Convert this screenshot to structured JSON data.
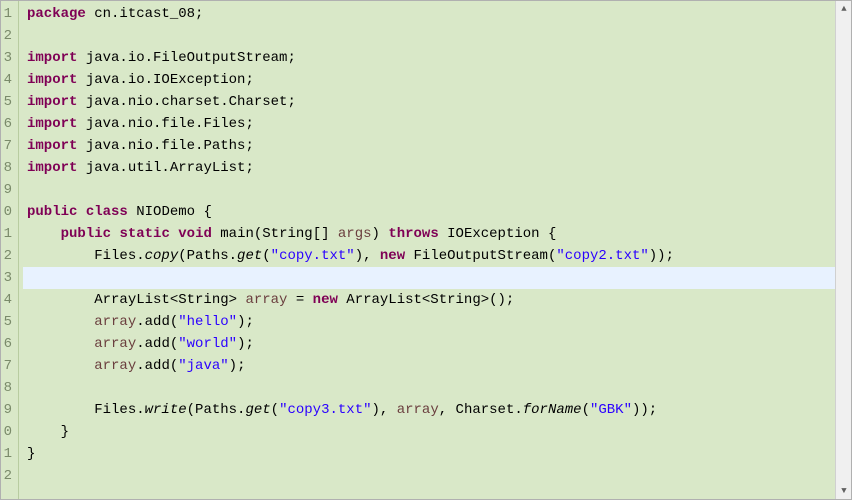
{
  "gutter": {
    "lines": [
      "1",
      "2",
      "3",
      "4",
      "5",
      "6",
      "7",
      "8",
      "9",
      "0",
      "1",
      "2",
      "3",
      "4",
      "5",
      "6",
      "7",
      "8",
      "9",
      "0",
      "1",
      "2"
    ]
  },
  "code": {
    "l1": {
      "kw": "package",
      "rest": " cn.itcast_08;"
    },
    "l3": {
      "kw": "import",
      "rest": " java.io.FileOutputStream;"
    },
    "l4": {
      "kw": "import",
      "rest": " java.io.IOException;"
    },
    "l5": {
      "kw": "import",
      "rest": " java.nio.charset.Charset;"
    },
    "l6": {
      "kw": "import",
      "rest": " java.nio.file.Files;"
    },
    "l7": {
      "kw": "import",
      "rest": " java.nio.file.Paths;"
    },
    "l8": {
      "kw": "import",
      "rest": " java.util.ArrayList;"
    },
    "l10": {
      "kw1": "public",
      "kw2": "class",
      "name": " NIODemo {"
    },
    "l11": {
      "indent": "    ",
      "kw1": "public",
      "kw2": "static",
      "kw3": "void",
      "name": " main(String[] ",
      "param": "args",
      "rest1": ") ",
      "kw4": "throws",
      "rest2": " IOException {"
    },
    "l12": {
      "indent": "        Files.",
      "method": "copy",
      "p1": "(Paths.",
      "method2": "get",
      "p2": "(",
      "str1": "\"copy.txt\"",
      "p3": "), ",
      "kw": "new",
      "p4": " FileOutputStream(",
      "str2": "\"copy2.txt\"",
      "p5": "));"
    },
    "l14": {
      "indent": "        ArrayList<String> ",
      "var": "array",
      "eq": " = ",
      "kw": "new",
      "rest": " ArrayList<String>();"
    },
    "l15": {
      "indent": "        ",
      "var": "array",
      "rest1": ".add(",
      "str": "\"hello\"",
      "rest2": ");"
    },
    "l16": {
      "indent": "        ",
      "var": "array",
      "rest1": ".add(",
      "str": "\"world\"",
      "rest2": ");"
    },
    "l17": {
      "indent": "        ",
      "var": "array",
      "rest1": ".add(",
      "str": "\"java\"",
      "rest2": ");"
    },
    "l19": {
      "indent": "        Files.",
      "method": "write",
      "p1": "(Paths.",
      "method2": "get",
      "p2": "(",
      "str1": "\"copy3.txt\"",
      "p3": "), ",
      "var": "array",
      "p4": ", Charset.",
      "method3": "forName",
      "p5": "(",
      "str2": "\"GBK\"",
      "p6": "));"
    },
    "l20": {
      "text": "    }"
    },
    "l21": {
      "text": "}"
    }
  }
}
